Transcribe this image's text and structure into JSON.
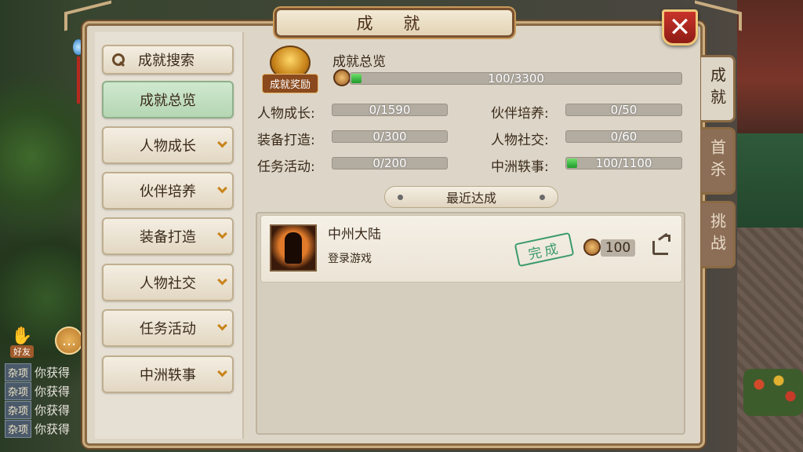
{
  "window": {
    "title": "成 就"
  },
  "close_button": {
    "label": "✕"
  },
  "side_tabs": [
    {
      "label": "成就"
    },
    {
      "label": "首杀"
    },
    {
      "label": "挑战"
    }
  ],
  "menu": {
    "search_label": "成就搜索",
    "overview_label": "成就总览",
    "categories": [
      {
        "label": "人物成长"
      },
      {
        "label": "伙伴培养"
      },
      {
        "label": "装备打造"
      },
      {
        "label": "人物社交"
      },
      {
        "label": "任务活动"
      },
      {
        "label": "中洲轶事"
      }
    ]
  },
  "overview": {
    "chest_label": "成就奖励",
    "title": "成就总览",
    "total_text": "100/3300",
    "total_progress": 0.03,
    "stats": [
      {
        "label": "人物成长:",
        "value": "0/1590",
        "progress": 0
      },
      {
        "label": "伙伴培养:",
        "value": "0/50",
        "progress": 0
      },
      {
        "label": "装备打造:",
        "value": "0/300",
        "progress": 0
      },
      {
        "label": "人物社交:",
        "value": "0/60",
        "progress": 0
      },
      {
        "label": "任务活动:",
        "value": "0/200",
        "progress": 0
      },
      {
        "label": "中洲轶事:",
        "value": "100/1100",
        "progress": 0.09
      }
    ]
  },
  "recent": {
    "header": "最近达成",
    "items": [
      {
        "name": "中州大陆",
        "desc": "登录游戏",
        "status": "完成",
        "reward": "100"
      }
    ]
  },
  "hud": {
    "friend_label": "好友",
    "chat": [
      {
        "tag": "杂项",
        "text": "你获得"
      },
      {
        "tag": "杂项",
        "text": "你获得"
      },
      {
        "tag": "杂项",
        "text": "你获得"
      },
      {
        "tag": "杂项",
        "text": "你获得"
      }
    ]
  },
  "colors": {
    "progress_fill": "#1e9a2a",
    "close_red": "#c8342a",
    "stamp_green": "#3a9a6a"
  }
}
